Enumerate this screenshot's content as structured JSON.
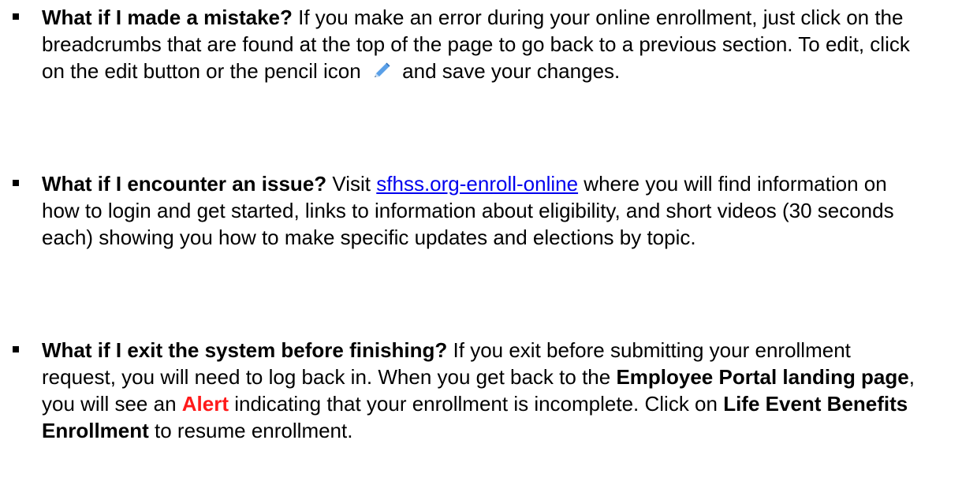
{
  "faq": [
    {
      "question": "What if I made a mistake?",
      "answer_before_icon": " If you make an error during your online enrollment, just click on the breadcrumbs that are found at the top of the page to go back to a previous section. To edit, click on the edit button or the pencil icon ",
      "answer_after_icon": " and save your changes.",
      "icon": "pencil-icon"
    },
    {
      "question": "What if I encounter an issue?",
      "answer_prefix": " Visit ",
      "link_text": "sfhss.org-enroll-online",
      "answer_suffix": " where you will find information on how to login and get started, links to information about eligibility, and short videos (30 seconds each) showing you how to make specific updates and elections by topic."
    },
    {
      "question": "What if I exit the system before finishing?",
      "text_1": " If you exit before submitting your enrollment request, you will need to log back in. When you get back to the ",
      "bold_1": "Employee Portal landing page",
      "text_2": ", you will see an ",
      "alert": "Alert",
      "text_3": " indicating that your enrollment is incomplete. Click on ",
      "bold_2": "Life Event Benefits Enrollment",
      "text_4": " to resume enrollment."
    }
  ],
  "colors": {
    "link": "#0000ee",
    "alert": "#ff1a1a",
    "pencil": "#5aa0e8"
  }
}
